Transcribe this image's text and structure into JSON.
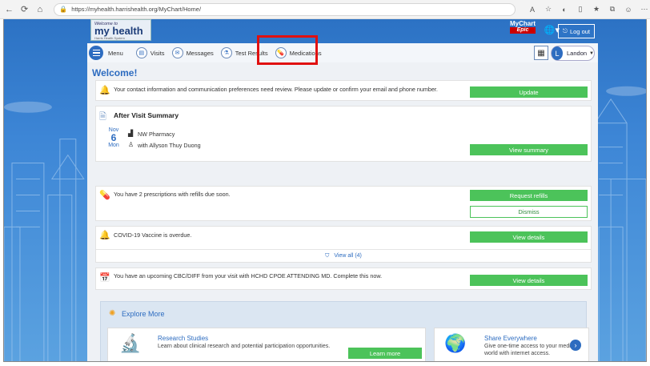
{
  "browser": {
    "url": "https://myhealth.harrishealth.org/MyChart/Home/"
  },
  "header": {
    "logo_small": "Welcome to",
    "logo_big": "my health",
    "logo_tagline": "Harris Health System",
    "mychart_label": "MyChart",
    "epic_label": "Epic",
    "logout_label": "Log out"
  },
  "nav": {
    "menu_label": "Menu",
    "items": [
      {
        "label": "Visits",
        "icon": "visits-icon"
      },
      {
        "label": "Messages",
        "icon": "messages-icon"
      },
      {
        "label": "Test Results",
        "icon": "test-results-icon"
      },
      {
        "label": "Medications",
        "icon": "medications-icon"
      }
    ],
    "user_initial": "L",
    "user_name": "Landon"
  },
  "main": {
    "welcome": "Welcome!",
    "contact_alert": {
      "text": "Your contact information and communication preferences need review. Please update or confirm your email and phone number.",
      "button": "Update"
    },
    "avs": {
      "title": "After Visit Summary",
      "month": "Nov",
      "day": "6",
      "weekday": "Mon",
      "location": "NW Pharmacy",
      "provider": "with Allyson Thuy Duong",
      "button": "View summary"
    },
    "refills": {
      "text": "You have 2 prescriptions with refills due soon.",
      "button": "Request refills",
      "dismiss": "Dismiss"
    },
    "vaccine": {
      "text": "COVID-19 Vaccine is overdue.",
      "button": "View details",
      "view_all": "View all (4)"
    },
    "questionnaire": {
      "text": "You have an upcoming CBC/DIFF from your visit with HCHD CPOE ATTENDING MD. Complete this now.",
      "button": "View details"
    },
    "explore": {
      "title": "Explore More",
      "cards": [
        {
          "title": "Research Studies",
          "desc": "Learn about clinical research and potential participation opportunities.",
          "button": "Learn more"
        },
        {
          "title": "Share Everywhere",
          "desc": "Give one-time access to your medical world with internet access."
        }
      ]
    }
  }
}
